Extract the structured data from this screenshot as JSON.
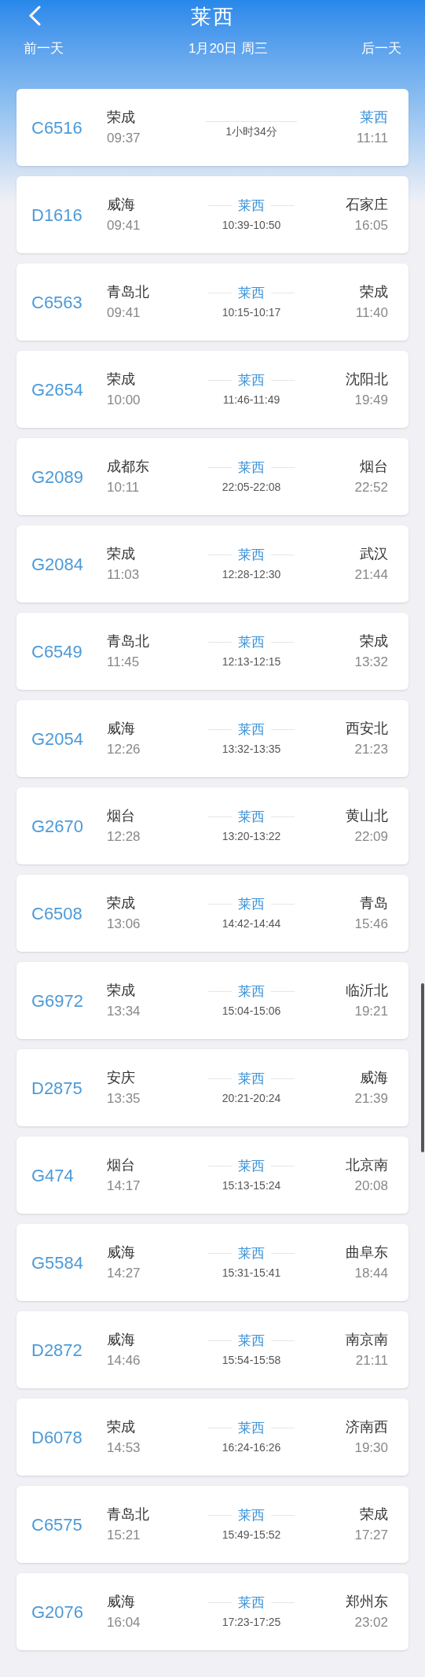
{
  "header": {
    "title": "莱西",
    "prev_day": "前一天",
    "date": "1月20日 周三",
    "next_day": "后一天"
  },
  "trains": [
    {
      "kind": "arrival",
      "number": "C6516",
      "from": "荣成",
      "depart": "09:37",
      "middle_bottom": "1小时34分",
      "to": "莱西",
      "arrive": "11:11"
    },
    {
      "kind": "through",
      "number": "D1616",
      "from": "威海",
      "depart": "09:41",
      "middle_top": "莱西",
      "middle_bottom": "10:39-10:50",
      "to": "石家庄",
      "arrive": "16:05"
    },
    {
      "kind": "through",
      "number": "C6563",
      "from": "青岛北",
      "depart": "09:41",
      "middle_top": "莱西",
      "middle_bottom": "10:15-10:17",
      "to": "荣成",
      "arrive": "11:40"
    },
    {
      "kind": "through",
      "number": "G2654",
      "from": "荣成",
      "depart": "10:00",
      "middle_top": "莱西",
      "middle_bottom": "11:46-11:49",
      "to": "沈阳北",
      "arrive": "19:49"
    },
    {
      "kind": "through",
      "number": "G2089",
      "from": "成都东",
      "depart": "10:11",
      "middle_top": "莱西",
      "middle_bottom": "22:05-22:08",
      "to": "烟台",
      "arrive": "22:52"
    },
    {
      "kind": "through",
      "number": "G2084",
      "from": "荣成",
      "depart": "11:03",
      "middle_top": "莱西",
      "middle_bottom": "12:28-12:30",
      "to": "武汉",
      "arrive": "21:44"
    },
    {
      "kind": "through",
      "number": "C6549",
      "from": "青岛北",
      "depart": "11:45",
      "middle_top": "莱西",
      "middle_bottom": "12:13-12:15",
      "to": "荣成",
      "arrive": "13:32"
    },
    {
      "kind": "through",
      "number": "G2054",
      "from": "威海",
      "depart": "12:26",
      "middle_top": "莱西",
      "middle_bottom": "13:32-13:35",
      "to": "西安北",
      "arrive": "21:23"
    },
    {
      "kind": "through",
      "number": "G2670",
      "from": "烟台",
      "depart": "12:28",
      "middle_top": "莱西",
      "middle_bottom": "13:20-13:22",
      "to": "黄山北",
      "arrive": "22:09"
    },
    {
      "kind": "through",
      "number": "C6508",
      "from": "荣成",
      "depart": "13:06",
      "middle_top": "莱西",
      "middle_bottom": "14:42-14:44",
      "to": "青岛",
      "arrive": "15:46"
    },
    {
      "kind": "through",
      "number": "G6972",
      "from": "荣成",
      "depart": "13:34",
      "middle_top": "莱西",
      "middle_bottom": "15:04-15:06",
      "to": "临沂北",
      "arrive": "19:21"
    },
    {
      "kind": "through",
      "number": "D2875",
      "from": "安庆",
      "depart": "13:35",
      "middle_top": "莱西",
      "middle_bottom": "20:21-20:24",
      "to": "威海",
      "arrive": "21:39"
    },
    {
      "kind": "through",
      "number": "G474",
      "from": "烟台",
      "depart": "14:17",
      "middle_top": "莱西",
      "middle_bottom": "15:13-15:24",
      "to": "北京南",
      "arrive": "20:08"
    },
    {
      "kind": "through",
      "number": "G5584",
      "from": "威海",
      "depart": "14:27",
      "middle_top": "莱西",
      "middle_bottom": "15:31-15:41",
      "to": "曲阜东",
      "arrive": "18:44"
    },
    {
      "kind": "through",
      "number": "D2872",
      "from": "威海",
      "depart": "14:46",
      "middle_top": "莱西",
      "middle_bottom": "15:54-15:58",
      "to": "南京南",
      "arrive": "21:11"
    },
    {
      "kind": "through",
      "number": "D6078",
      "from": "荣成",
      "depart": "14:53",
      "middle_top": "莱西",
      "middle_bottom": "16:24-16:26",
      "to": "济南西",
      "arrive": "19:30"
    },
    {
      "kind": "through",
      "number": "C6575",
      "from": "青岛北",
      "depart": "15:21",
      "middle_top": "莱西",
      "middle_bottom": "15:49-15:52",
      "to": "荣成",
      "arrive": "17:27"
    },
    {
      "kind": "through",
      "number": "G2076",
      "from": "威海",
      "depart": "16:04",
      "middle_top": "莱西",
      "middle_bottom": "17:23-17:25",
      "to": "郑州东",
      "arrive": "23:02"
    }
  ]
}
